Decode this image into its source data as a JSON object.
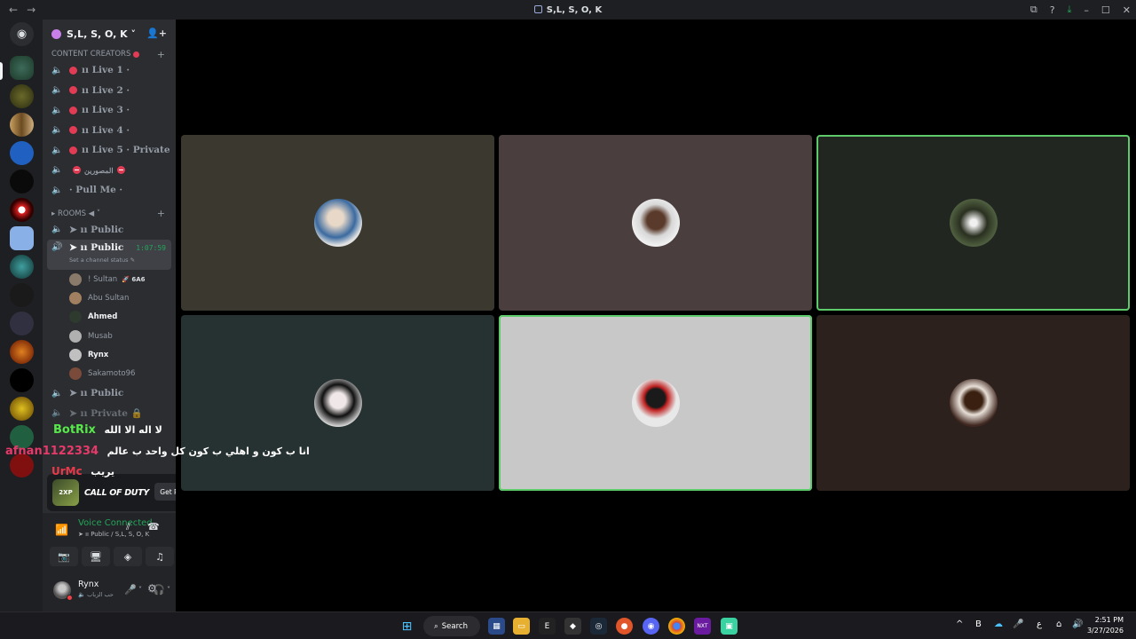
{
  "window": {
    "title": "S,L, S, O, K",
    "back": "←",
    "forward": "→",
    "icons": {
      "screen": "⧉",
      "help": "?",
      "download": "⤓",
      "minimize": "–",
      "maximize": "☐",
      "close": "✕"
    }
  },
  "server": {
    "name": "S,L, S, O, K ˅",
    "invite_icon": "👤+"
  },
  "categories": {
    "content": {
      "label": "CONTENT CREATORS",
      "plus": "+"
    },
    "rooms": {
      "label": "▸ ROOMS ◀ ˅",
      "plus": "+"
    }
  },
  "content_channels": [
    {
      "label": "ıı Live 1 ·"
    },
    {
      "label": "ıı Live 2 ·"
    },
    {
      "label": "ıı Live 3 ·"
    },
    {
      "label": "ıı Live 4 ·"
    },
    {
      "label": "ıı Live 5 · Private"
    }
  ],
  "special_channels": {
    "mosawer": "المصورين",
    "pull_me": "· Pull Me ·"
  },
  "rooms": {
    "public1": "➤ ıı Public",
    "public_active": "➤ ıı Public",
    "active_time": "1:07:59",
    "active_status": "Set a channel status ✎",
    "public3": "➤ ıı Public",
    "private": "➤ ıı Private 🔒"
  },
  "members": [
    {
      "name": "! Sultan",
      "badge": "🚀 6A6",
      "bold": false,
      "color": "#8a7a6a"
    },
    {
      "name": "Abu Sultan",
      "badge": "",
      "bold": false,
      "color": "#a08060"
    },
    {
      "name": "Ahmed",
      "badge": "",
      "bold": true,
      "color": "#2d3a2d"
    },
    {
      "name": "Musab",
      "badge": "",
      "bold": false,
      "color": "#b0b0b0"
    },
    {
      "name": "Rynx",
      "badge": "",
      "bold": true,
      "color": "#c0c0c0"
    },
    {
      "name": "Sakamoto96",
      "badge": "",
      "bold": false,
      "color": "#7a4a3a"
    }
  ],
  "overlay_chat": [
    {
      "user": "BotRix",
      "message": "لا اله الا الله",
      "user_color": "#57e84a"
    },
    {
      "user": "afnan1122334",
      "message": "انا ب كون و اهلي ب كون كل واحد ب عالم",
      "user_color": "#e83a6a"
    },
    {
      "user": "UrMc",
      "message": "يريب",
      "user_color": "#e83a4a"
    }
  ],
  "promo": {
    "title": "CALL OF DUTY",
    "icon_text": "2XP",
    "button": "Get Reward!"
  },
  "voice": {
    "status": "Voice Connected",
    "channel": "➤ ıı Public / S,L, S, O, K",
    "icons": {
      "signal": "📶",
      "noise": "⫽",
      "disconnect": "☎",
      "camera": "📷",
      "screen": "🖥",
      "activity": "◈",
      "soundboard": "♫"
    }
  },
  "user": {
    "name": "Rynx",
    "status": "🔈 حب الزباب",
    "icons": {
      "mic": "🎤",
      "chevron": "˅",
      "headset": "🎧",
      "settings": "⚙"
    }
  },
  "tiles": [
    {
      "bg": "#3b392f",
      "speaking": false
    },
    {
      "bg": "#4a3e3e",
      "speaking": false
    },
    {
      "bg": "#222621",
      "speaking": true
    },
    {
      "bg": "#263131",
      "speaking": false
    },
    {
      "bg": "#c8c8c8",
      "speaking": true
    },
    {
      "bg": "#2d211e",
      "speaking": false
    }
  ],
  "taskbar": {
    "search": "Search",
    "clock_time": "2:51 PM",
    "clock_date": "3/27/2026",
    "lang": "ع",
    "tray_up": "^",
    "tray_b": "B"
  }
}
